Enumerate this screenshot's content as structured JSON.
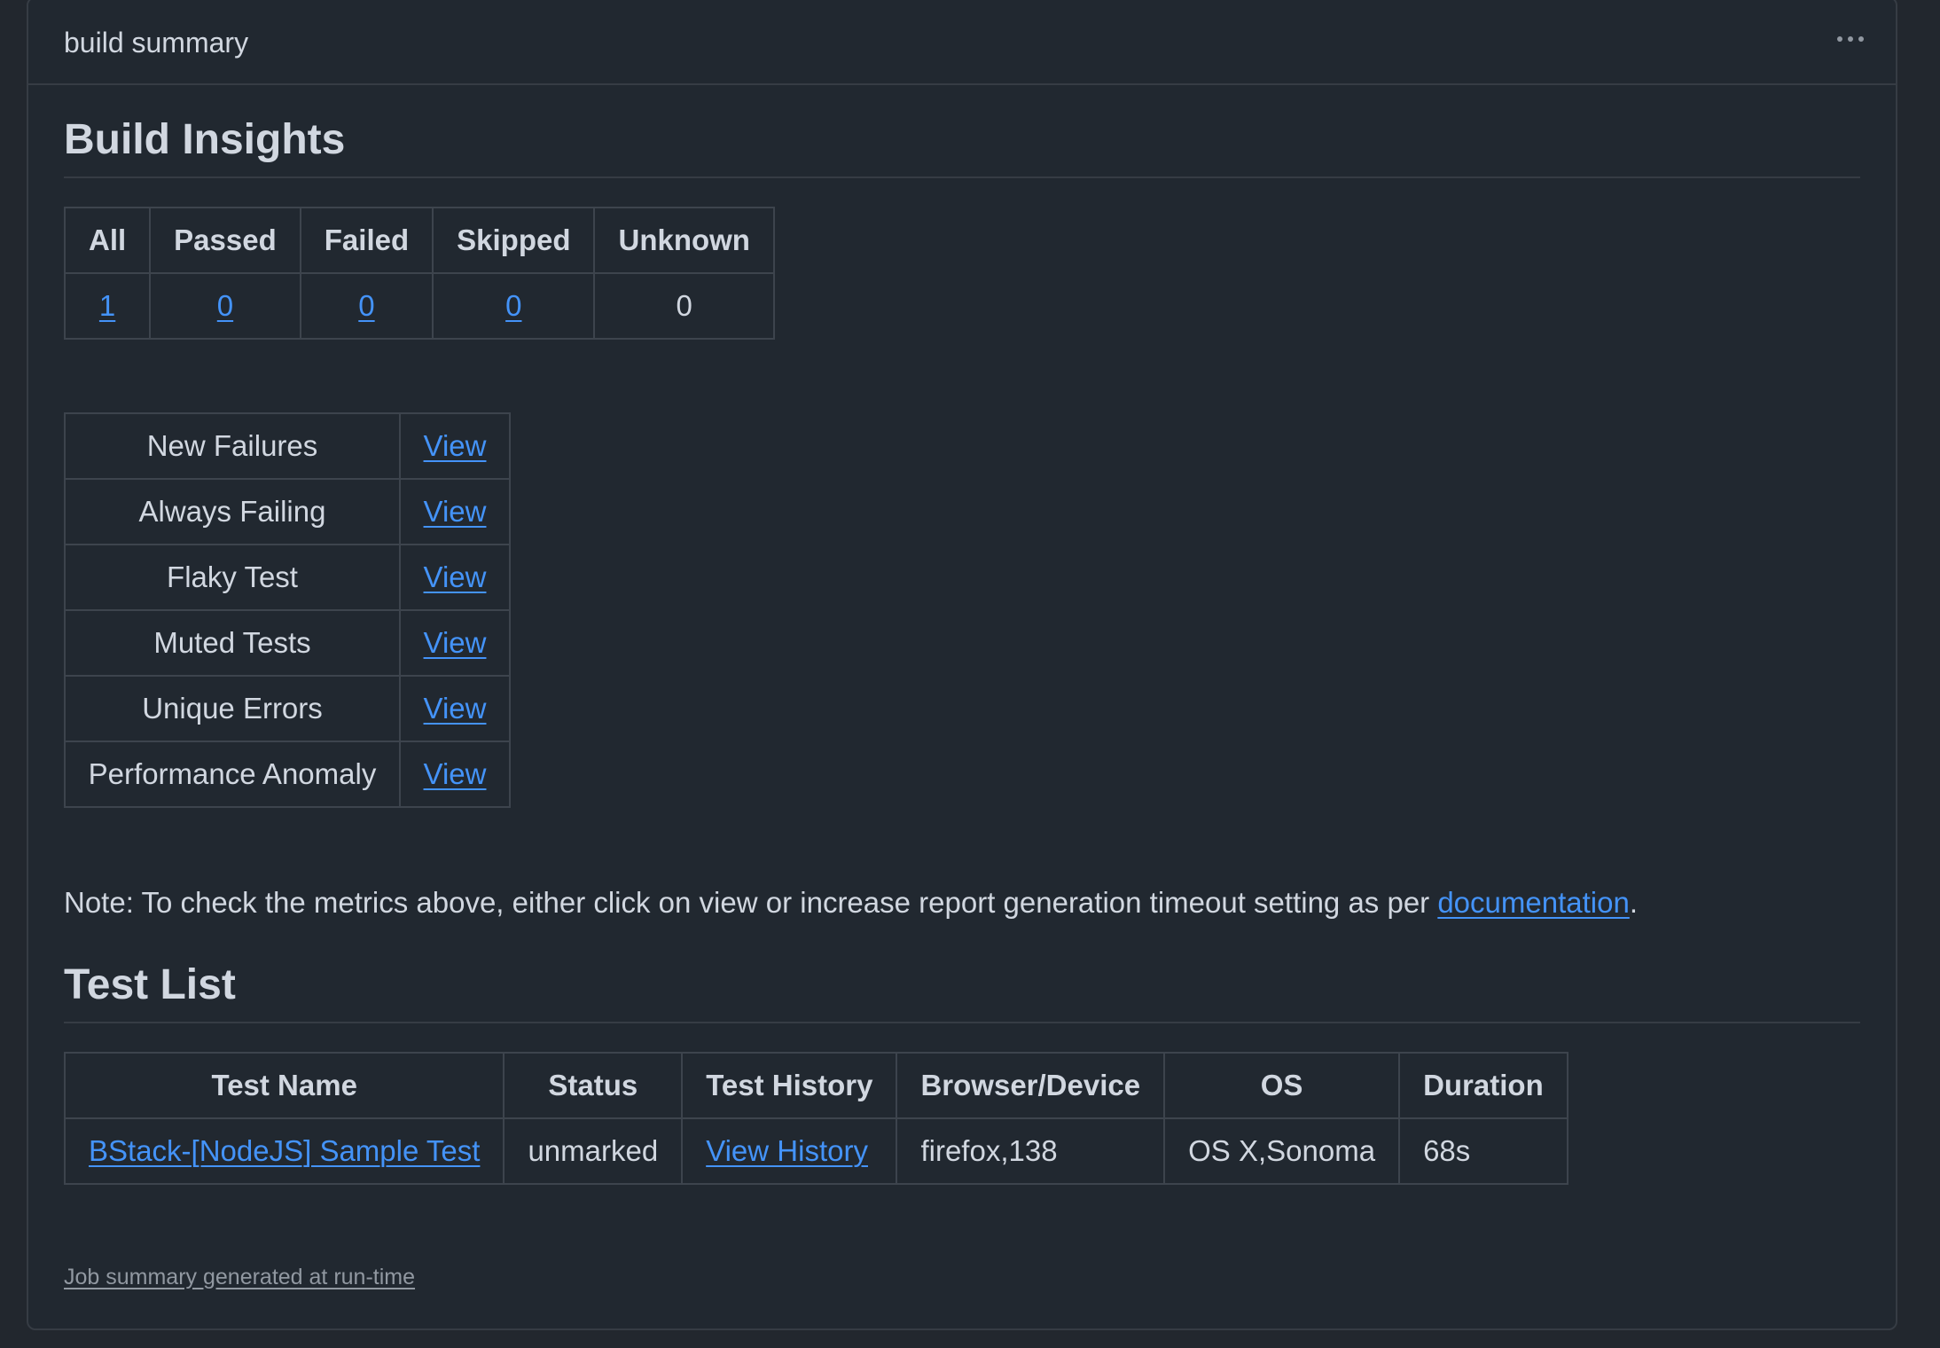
{
  "panel": {
    "title": "build summary",
    "menu_icon": "kebab-horizontal-icon"
  },
  "insights": {
    "heading": "Build Insights",
    "counts": {
      "headers": [
        "All",
        "Passed",
        "Failed",
        "Skipped",
        "Unknown"
      ],
      "values": [
        "1",
        "0",
        "0",
        "0",
        "0"
      ]
    },
    "reports": [
      {
        "label": "New Failures",
        "link": "View"
      },
      {
        "label": "Always Failing",
        "link": "View"
      },
      {
        "label": "Flaky Test",
        "link": "View"
      },
      {
        "label": "Muted Tests",
        "link": "View"
      },
      {
        "label": "Unique Errors",
        "link": "View"
      },
      {
        "label": "Performance Anomaly",
        "link": "View"
      }
    ],
    "note_prefix": "Note: To check the metrics above, either click on view or increase report generation timeout setting as per ",
    "note_link": "documentation",
    "note_suffix": "."
  },
  "tests": {
    "heading": "Test List",
    "headers": [
      "Test Name",
      "Status",
      "Test History",
      "Browser/Device",
      "OS",
      "Duration"
    ],
    "rows": [
      {
        "name": "BStack-[NodeJS] Sample Test",
        "status": "unmarked",
        "history": "View History",
        "browser": "firefox,138",
        "os": "OS X,Sonoma",
        "duration": "68s"
      }
    ]
  },
  "footer": "Job summary generated at run-time",
  "colors": {
    "background": "#212830",
    "border": "#363c44",
    "text": "#d1d7e0",
    "link": "#4493f8",
    "muted": "#9198a1"
  }
}
